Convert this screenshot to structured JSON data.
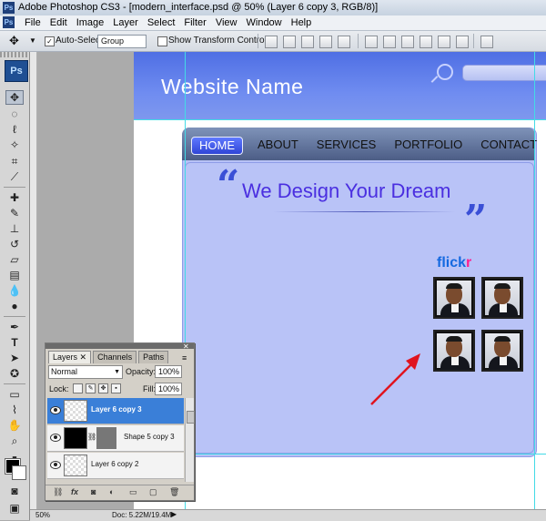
{
  "window": {
    "title": "Adobe Photoshop CS3 - [modern_interface.psd @ 50% (Layer 6 copy 3, RGB/8)]",
    "app_badge": "Ps"
  },
  "menu": [
    "File",
    "Edit",
    "Image",
    "Layer",
    "Select",
    "Filter",
    "View",
    "Window",
    "Help"
  ],
  "options_bar": {
    "auto_select_label": "Auto-Select:",
    "auto_select_value": "Group",
    "show_transform_label": "Show Transform Controls"
  },
  "canvas": {
    "site_name": "Website Name",
    "nav": [
      "HOME",
      "ABOUT",
      "SERVICES",
      "PORTFOLIO",
      "CONTACT"
    ],
    "tagline": "We Design Your Dream",
    "quote_open": "“",
    "quote_close": "”",
    "flickr_a": "flick",
    "flickr_b": "r",
    "colors": {
      "header": "#5d79ea",
      "panel": "#b9c3f7",
      "tagline": "#4a2fe0",
      "flickr_blue": "#1469e0",
      "flickr_pink": "#ff1f8e",
      "guide": "#43dbe6",
      "arrow": "#e0141f"
    }
  },
  "layers_panel": {
    "tabs": [
      "Layers",
      "Channels",
      "Paths"
    ],
    "blend_mode": "Normal",
    "opacity_label": "Opacity:",
    "opacity_value": "100%",
    "lock_label": "Lock:",
    "fill_label": "Fill:",
    "fill_value": "100%",
    "layers": [
      {
        "name": "Layer 6 copy 3",
        "selected": true
      },
      {
        "name": "Shape 5 copy 3",
        "selected": false
      },
      {
        "name": "Layer 6 copy 2",
        "selected": false
      }
    ]
  },
  "statusbar": {
    "zoom": "50%",
    "doc": "Doc: 5.22M/19.4M"
  },
  "icons": [
    "move-icon",
    "marquee-icon",
    "lasso-icon",
    "magic-wand-icon",
    "crop-icon",
    "slice-icon",
    "healing-icon",
    "brush-icon",
    "stamp-icon",
    "history-brush-icon",
    "eraser-icon",
    "gradient-icon",
    "blur-icon",
    "dodge-icon",
    "pen-icon",
    "type-icon",
    "path-select-icon",
    "shape-icon",
    "notes-icon",
    "eyedropper-icon",
    "hand-icon",
    "zoom-icon"
  ]
}
